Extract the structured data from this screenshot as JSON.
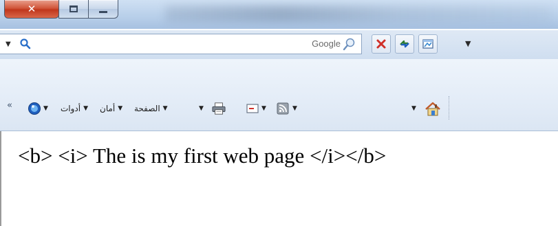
{
  "window": {
    "close_glyph": "✕",
    "title_blurred": "Microsoft Visual Studio"
  },
  "search": {
    "placeholder": "Google",
    "dropdown_glyph": "▼"
  },
  "command_bar": {
    "overflow_glyph": "«",
    "items": {
      "tools": "أدوات",
      "safety": "أمان",
      "page": "الصفحة"
    },
    "dropdown_glyph": "▼"
  },
  "content": {
    "text": "<b> <i> The is my first web page </i></b>"
  },
  "icons": {
    "search": "magnifier-icon",
    "search_go": "search-go-icon",
    "stop": "stop-icon",
    "refresh": "refresh-icon",
    "compat": "compatibility-view-icon",
    "home": "home-icon",
    "feeds": "feeds-icon",
    "mail": "read-mail-icon",
    "print": "print-icon",
    "help": "help-icon"
  },
  "colors": {
    "close_red": "#c0371d",
    "chrome_blue": "#b9d0ea",
    "stop_red": "#d0302a"
  }
}
